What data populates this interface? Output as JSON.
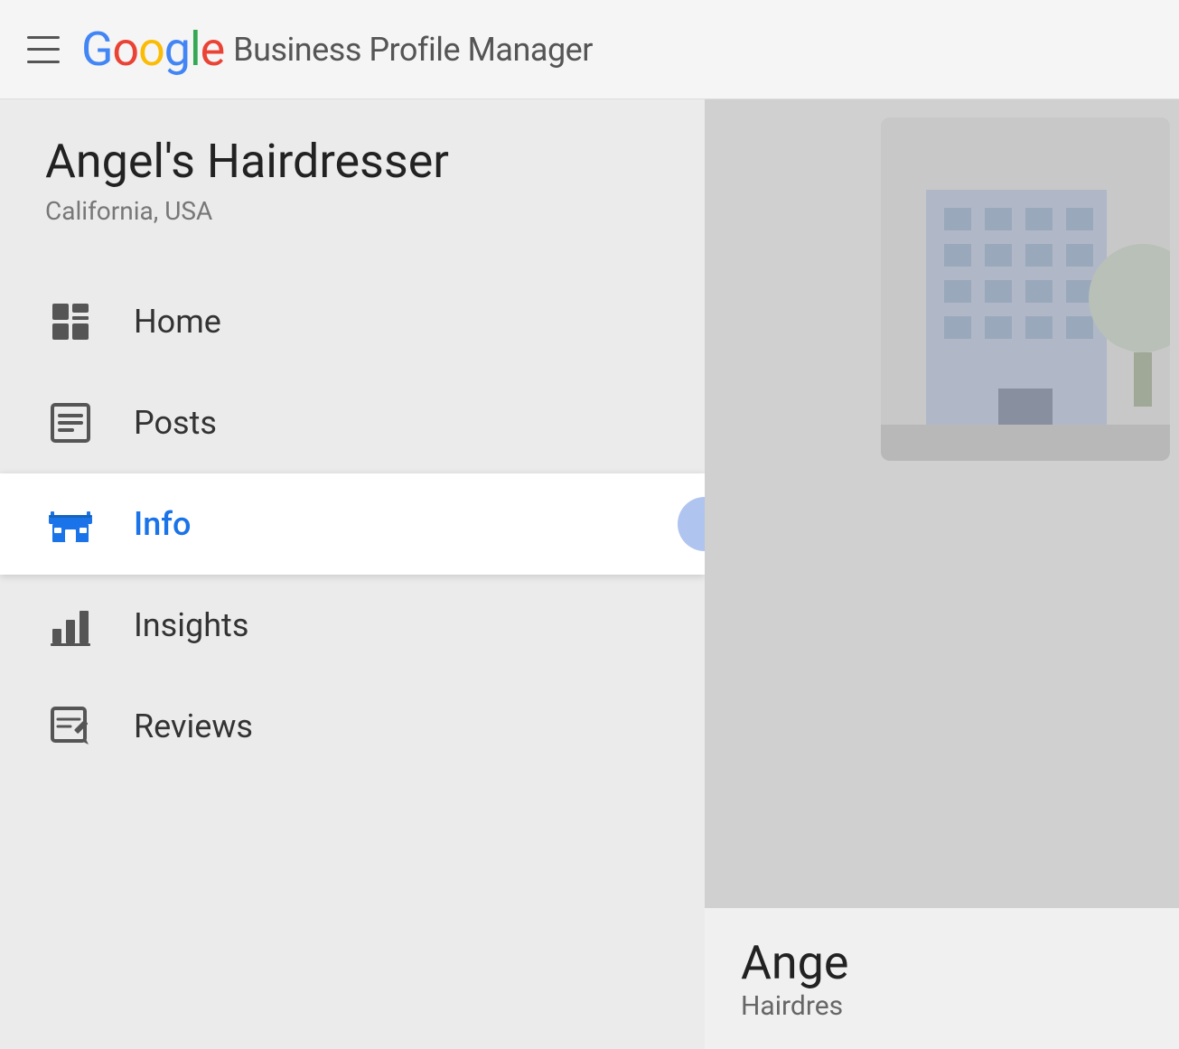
{
  "header": {
    "hamburger_label": "Menu",
    "google_text": "Google",
    "title": "Business Profile Manager",
    "google_letters": [
      {
        "char": "G",
        "color": "g-blue"
      },
      {
        "char": "o",
        "color": "g-red"
      },
      {
        "char": "o",
        "color": "g-yellow"
      },
      {
        "char": "g",
        "color": "g-blue"
      },
      {
        "char": "l",
        "color": "g-green"
      },
      {
        "char": "e",
        "color": "g-red"
      }
    ]
  },
  "sidebar": {
    "business_name": "Angel's Hairdresser",
    "business_location": "California, USA",
    "nav_items": [
      {
        "id": "home",
        "label": "Home",
        "icon": "home-icon",
        "active": false
      },
      {
        "id": "posts",
        "label": "Posts",
        "icon": "posts-icon",
        "active": false
      },
      {
        "id": "info",
        "label": "Info",
        "icon": "info-icon",
        "active": true
      },
      {
        "id": "insights",
        "label": "Insights",
        "icon": "insights-icon",
        "active": false
      },
      {
        "id": "reviews",
        "label": "Reviews",
        "icon": "reviews-icon",
        "active": false
      }
    ]
  },
  "right_panel": {
    "business_card_name": "Ange",
    "business_card_type": "Hairdres"
  },
  "colors": {
    "active_blue": "#1a73e8",
    "active_bg": "#ffffff",
    "inactive_bg": "#ebebeb"
  }
}
